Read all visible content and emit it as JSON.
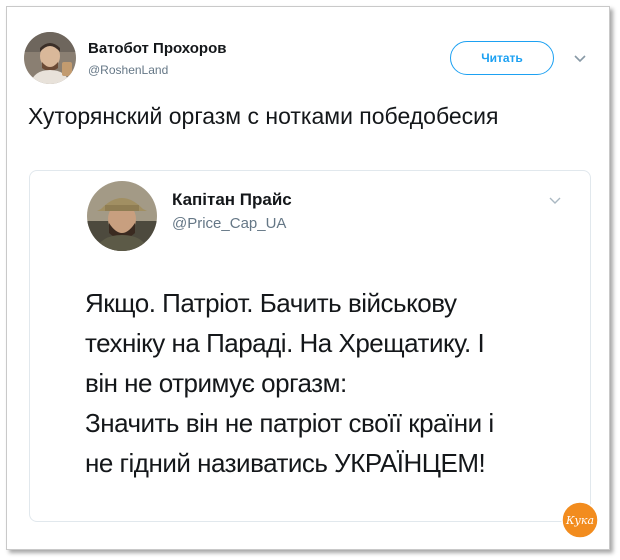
{
  "tweet": {
    "author_name": "Ватобот Прохоров",
    "author_handle": "@RoshenLand",
    "follow_label": "Читать",
    "text": "Хуторянский оргазм с нотками победобесия"
  },
  "quoted_tweet": {
    "author_name": "Капітан Прайс",
    "author_handle": "@Price_Cap_UA",
    "lines": [
      "Якщо. Патріот. Бачить військову",
      "техніку на Параді. На Хрещатику. І",
      "він не отримує оргазм:",
      "Значить він не патріот своїї країни і",
      "не гідний називатись УКРАЇНЦЕМ!"
    ]
  },
  "watermark": {
    "text": "Кука"
  },
  "icons": {
    "avatar": "user-avatar-icon",
    "quoted_avatar": "quoted-avatar-icon",
    "caret": "chevron-down-icon",
    "watermark": "watermark-logo-icon"
  },
  "colors": {
    "accent": "#1da1f2",
    "text": "#14171a",
    "muted": "#657786",
    "border": "#e1e8ed",
    "watermark": "#f28c1e"
  }
}
